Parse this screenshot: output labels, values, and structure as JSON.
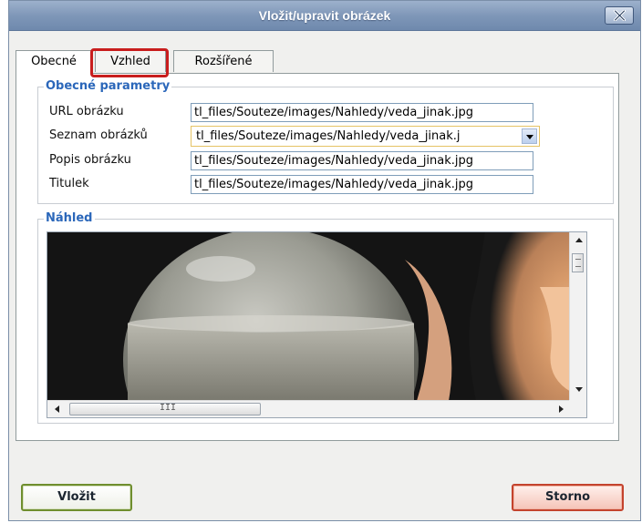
{
  "dialog": {
    "title": "Vložit/upravit obrázek"
  },
  "tabs": [
    {
      "label": "Obecné",
      "active": true
    },
    {
      "label": "Vzhled",
      "active": false,
      "highlighted": true
    },
    {
      "label": "Rozšířené",
      "active": false
    }
  ],
  "general": {
    "legend": "Obecné parametry",
    "fields": [
      {
        "label": "URL obrázku",
        "value": "tl_files/Souteze/images/Nahledy/veda_jinak.jpg"
      },
      {
        "label": "Seznam obrázků",
        "value": "tl_files/Souteze/images/Nahledy/veda_jinak.j"
      },
      {
        "label": "Popis obrázku",
        "value": "tl_files/Souteze/images/Nahledy/veda_jinak.jpg"
      },
      {
        "label": "Titulek",
        "value": "tl_files/Souteze/images/Nahledy/veda_jinak.jpg"
      }
    ]
  },
  "preview": {
    "legend": "Náhled",
    "hscroll_grip": "III"
  },
  "buttons": {
    "insert": "Vložit",
    "cancel": "Storno"
  },
  "colors": {
    "accent": "#2b67ba",
    "highlight": "#c81d1d",
    "insert_border": "#6f8e2e",
    "cancel_border": "#c4432d"
  }
}
